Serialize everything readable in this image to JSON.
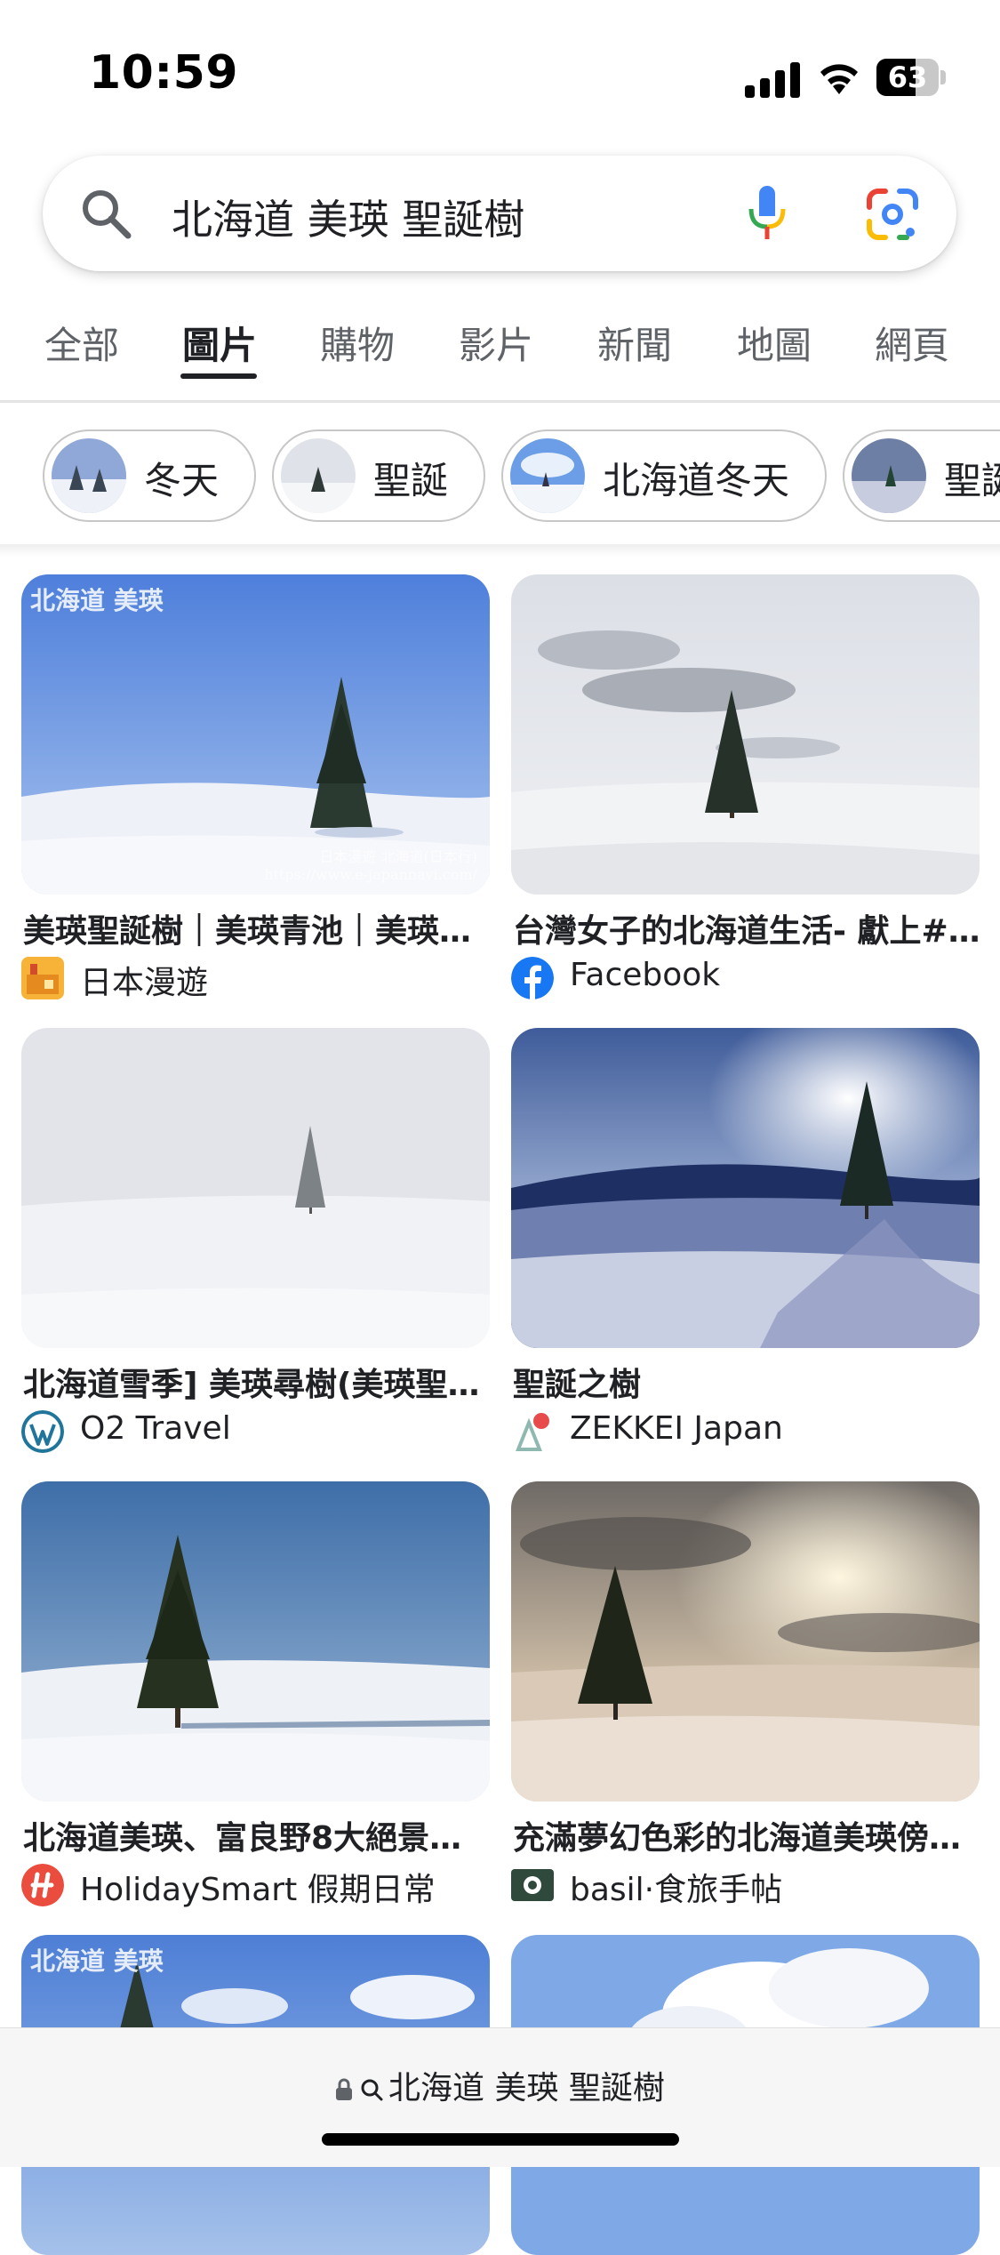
{
  "status_bar": {
    "time": "10:59",
    "battery_percent": 63
  },
  "search": {
    "query": "北海道 美瑛 聖誕樹",
    "left_icon": "search-icon",
    "right_icons": [
      "microphone-icon",
      "google-lens-icon"
    ]
  },
  "tabs": [
    "全部",
    "圖片",
    "購物",
    "影片",
    "新聞",
    "地圖",
    "網頁"
  ],
  "active_tab": "圖片",
  "chips": [
    "冬天",
    "聖誕",
    "北海道冬天",
    "聖誕"
  ],
  "results": [
    {
      "title": "美瑛聖誕樹｜美瑛青池｜美瑛…",
      "source": "日本漫遊",
      "overlay": "北海道 美瑛",
      "watermark": "日本漫遊 北海道(日本行) https://www.e-japannavi.com/"
    },
    {
      "title": "台灣女子的北海道生活- 獻上#…",
      "source": "Facebook"
    },
    {
      "title": "北海道雪季] 美瑛尋樹(美瑛聖…",
      "source": "O2 Travel"
    },
    {
      "title": "聖誕之樹",
      "source": "ZEKKEI Japan"
    },
    {
      "title": "北海道美瑛、富良野8大絕景！…",
      "source": "HolidaySmart 假期日常"
    },
    {
      "title": "充滿夢幻色彩的北海道美瑛傍…",
      "source": "basil·食旅手帖"
    },
    {
      "overlay": "北海道 美瑛"
    }
  ],
  "bottom_bar": {
    "url_text": "北海道 美瑛 聖誕樹"
  },
  "colors": {
    "google_blue": "#4285F4",
    "google_red": "#EA4335",
    "google_yellow": "#FBBC05",
    "google_green": "#34A853",
    "facebook_blue": "#1877F2"
  }
}
